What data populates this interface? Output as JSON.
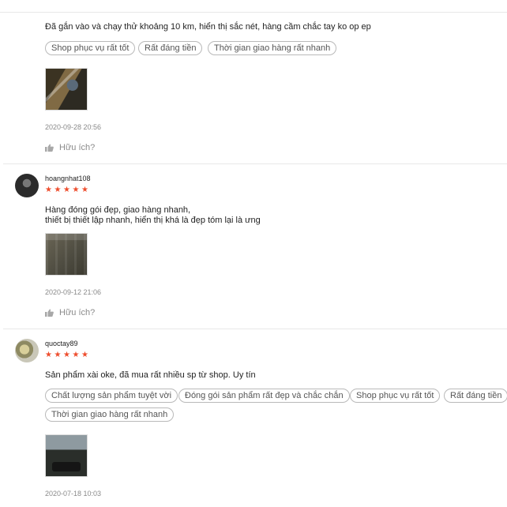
{
  "reviews": [
    {
      "content": "Đã gắn vào và chạy thử khoảng 10 km, hiển thị sắc nét, hàng cầm chắc tay ko op ep",
      "tags": [
        "Shop phục vụ rất tốt",
        "Rất đáng tiền",
        "Thời gian giao hàng rất nhanh"
      ],
      "date": "2020-09-28 20:56",
      "helpful_label": "Hữu ích?"
    },
    {
      "username": "hoangnhat108",
      "rating": 5,
      "content": "Hàng đóng gói đẹp, giao hàng nhanh,\nthiết bị thiết lập nhanh, hiển thị khá là đẹp tóm lại là ưng",
      "date": "2020-09-12 21:06",
      "helpful_label": "Hữu ích?"
    },
    {
      "username": "quoctay89",
      "rating": 5,
      "content": "Sản phẩm xài oke, đã mua rất nhiều sp từ shop. Uy tín",
      "tags": [
        "Chất lượng sản phẩm tuyệt vời",
        "Đóng gói sản phẩm rất đẹp và chắc chắn",
        "Shop phục vụ rất tốt",
        "Rất đáng tiền",
        "Thời gian giao hàng rất nhanh"
      ],
      "date": "2020-07-18 10:03"
    }
  ],
  "icons": {
    "star": "star-icon",
    "like": "thumbs-up-icon"
  },
  "colors": {
    "star": "#ee4d2d",
    "muted": "#8a8a8a",
    "divider": "#e8e8e8"
  }
}
